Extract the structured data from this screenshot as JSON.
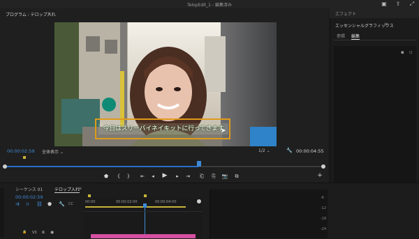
{
  "app": {
    "title": "TelopEdit_1 - 編集済み"
  },
  "program_panel": {
    "tab_label": "プログラム : テロップ入れ",
    "menu_icon": "≡",
    "caption": "今日はスリーバイネイキットに行ってきます",
    "current_time": "00:00:02:59",
    "fit_label": "全体表示",
    "resolution": "1/2",
    "duration": "00:00:04:55"
  },
  "essential_graphics": {
    "effects_label": "エフェクト",
    "title": "エッセンシャルグラフィックス",
    "tabs": [
      "参照",
      "編集"
    ]
  },
  "timeline": {
    "tab_seq1": "シーケンス 01",
    "tab_seq2": "テロップ入れ",
    "timecode": "00:00:02:59",
    "ruler": [
      "00:00",
      "00:00:02:00",
      "00:00:04:00"
    ],
    "track_v3": "V3"
  },
  "meter_ticks": [
    "-6",
    "-12",
    "-18",
    "-24"
  ]
}
